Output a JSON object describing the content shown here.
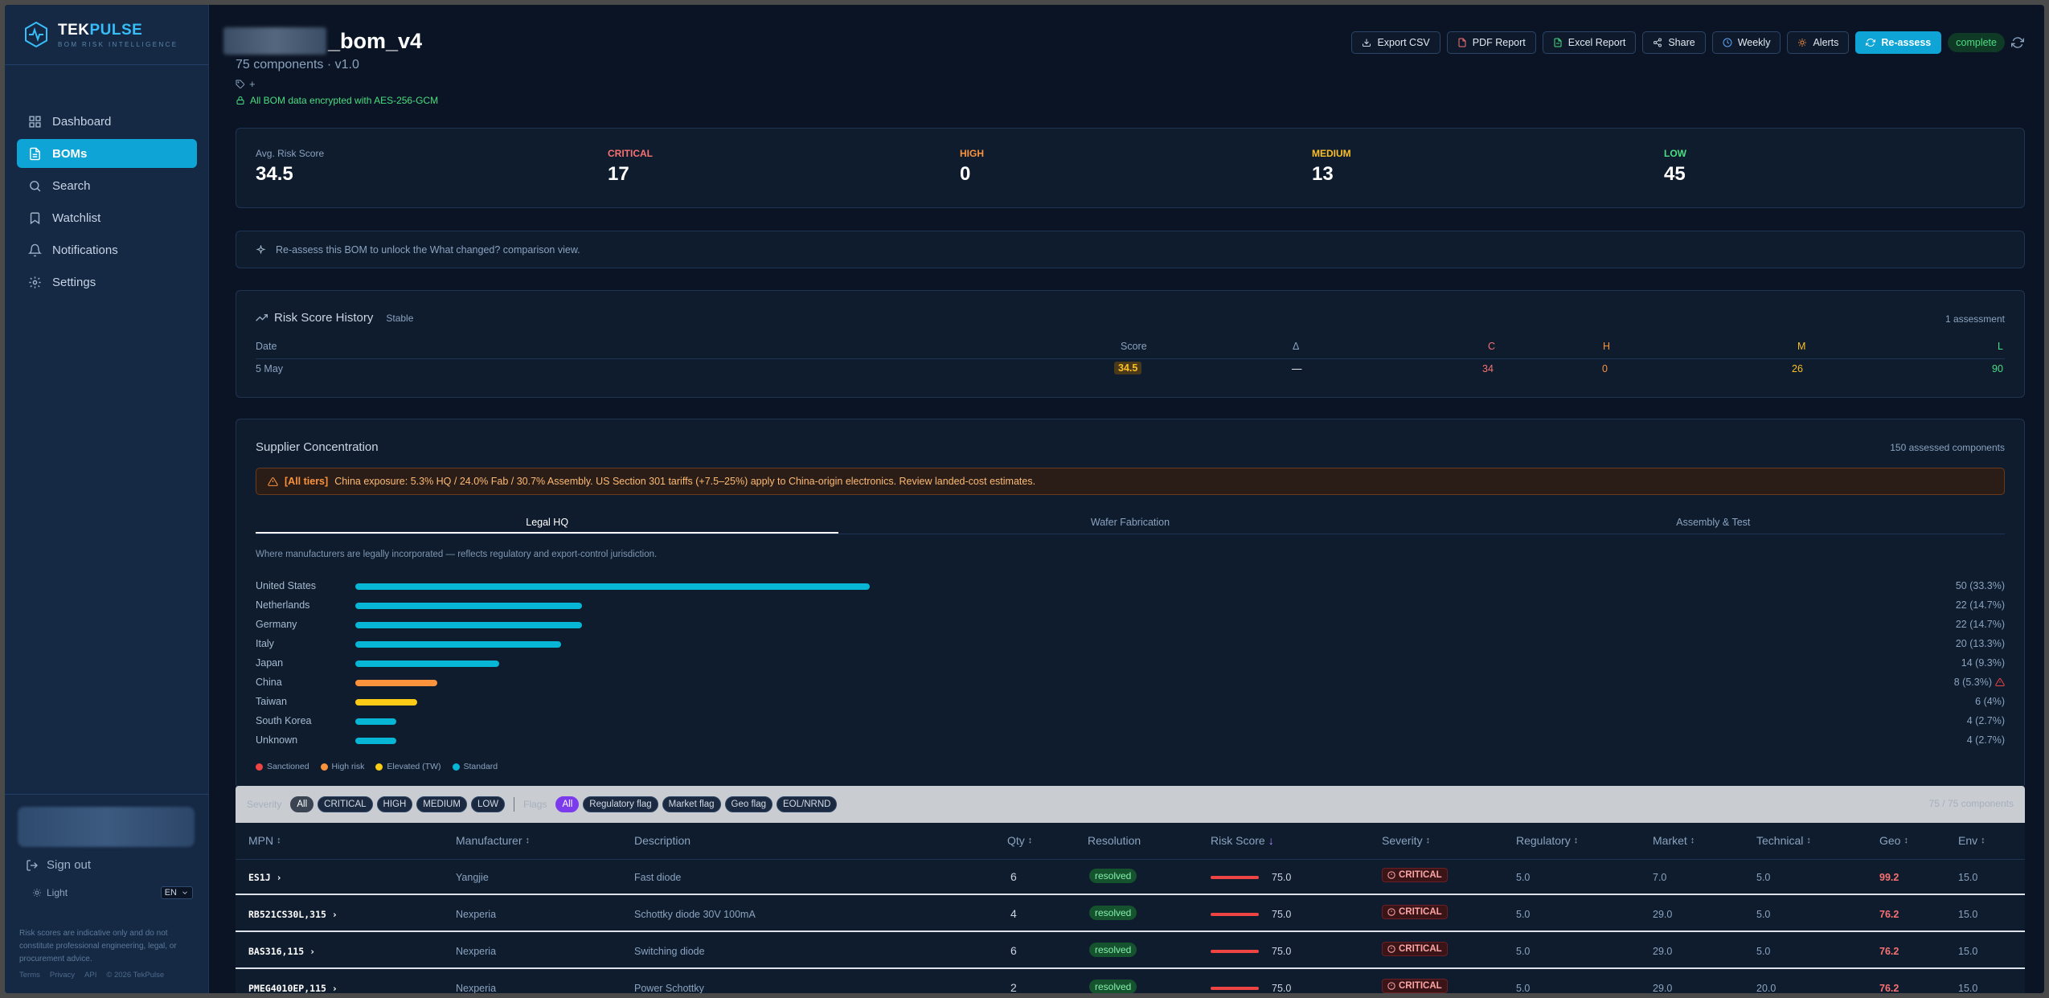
{
  "brand": {
    "name_a": "TEK",
    "name_b": "PULSE",
    "tagline": "BOM RISK INTELLIGENCE"
  },
  "sidebar": {
    "items": [
      {
        "label": "Dashboard",
        "icon": "grid-icon"
      },
      {
        "label": "BOMs",
        "icon": "document-icon"
      },
      {
        "label": "Search",
        "icon": "search-icon"
      },
      {
        "label": "Watchlist",
        "icon": "bookmark-icon"
      },
      {
        "label": "Notifications",
        "icon": "bell-icon"
      },
      {
        "label": "Settings",
        "icon": "gear-icon"
      }
    ],
    "sign_out": "Sign out",
    "theme_label": "Light",
    "language": "EN",
    "disclaimer": "Risk scores are indicative only and do not constitute professional engineering, legal, or procurement advice.",
    "footer": {
      "terms": "Terms",
      "privacy": "Privacy",
      "api": "API",
      "copyright": "© 2026 TekPulse"
    }
  },
  "header": {
    "title_suffix": "_bom_v4",
    "subtitle": "75 components · v1.0",
    "tag_add": "+",
    "encryption": "All BOM data encrypted with AES-256-GCM"
  },
  "toolbar": {
    "export_csv": "Export CSV",
    "pdf_report": "PDF Report",
    "excel_report": "Excel Report",
    "share": "Share",
    "weekly": "Weekly",
    "alerts": "Alerts",
    "reassess": "Re-assess",
    "status": "complete"
  },
  "stats": {
    "avg_label": "Avg. Risk Score",
    "avg_value": "34.5",
    "critical_label": "CRITICAL",
    "critical_value": "17",
    "high_label": "HIGH",
    "high_value": "0",
    "medium_label": "MEDIUM",
    "medium_value": "13",
    "low_label": "LOW",
    "low_value": "45"
  },
  "info_banner": "Re-assess this BOM to unlock the What changed? comparison view.",
  "history": {
    "title": "Risk Score History",
    "trend": "Stable",
    "count": "1 assessment",
    "headers": {
      "date": "Date",
      "score": "Score",
      "delta": "Δ",
      "c": "C",
      "h": "H",
      "m": "M",
      "l": "L"
    },
    "rows": [
      {
        "date": "5 May",
        "score": "34.5",
        "delta": "—",
        "c": "34",
        "h": "0",
        "m": "26",
        "l": "90"
      }
    ]
  },
  "supplier": {
    "title": "Supplier Concentration",
    "count": "150 assessed components",
    "alert_tag": "[All tiers]",
    "alert_text": "China exposure: 5.3% HQ / 24.0% Fab / 30.7% Assembly. US Section 301 tariffs (+7.5–25%) apply to China-origin electronics. Review landed-cost estimates.",
    "tabs": [
      "Legal HQ",
      "Wafer Fabrication",
      "Assembly & Test"
    ],
    "active_tab": 0,
    "tab_description": "Where manufacturers are legally incorporated — reflects regulatory and export-control jurisdiction.",
    "rows": [
      {
        "country": "United States",
        "count": 50,
        "label": "50 (33.3%)",
        "risk": "standard"
      },
      {
        "country": "Netherlands",
        "count": 22,
        "label": "22 (14.7%)",
        "risk": "standard"
      },
      {
        "country": "Germany",
        "count": 22,
        "label": "22 (14.7%)",
        "risk": "standard"
      },
      {
        "country": "Italy",
        "count": 20,
        "label": "20 (13.3%)",
        "risk": "standard"
      },
      {
        "country": "Japan",
        "count": 14,
        "label": "14 (9.3%)",
        "risk": "standard"
      },
      {
        "country": "China",
        "count": 8,
        "label": "8 (5.3%)",
        "risk": "high",
        "warn": true
      },
      {
        "country": "Taiwan",
        "count": 6,
        "label": "6 (4%)",
        "risk": "elevated"
      },
      {
        "country": "South Korea",
        "count": 4,
        "label": "4 (2.7%)",
        "risk": "standard"
      },
      {
        "country": "Unknown",
        "count": 4,
        "label": "4 (2.7%)",
        "risk": "standard"
      }
    ],
    "legend": [
      {
        "label": "Sanctioned",
        "color": "#ef4444"
      },
      {
        "label": "High risk",
        "color": "#fb923c"
      },
      {
        "label": "Elevated (TW)",
        "color": "#facc15"
      },
      {
        "label": "Standard",
        "color": "#06b6d4"
      }
    ],
    "colors": {
      "standard": "#06b6d4",
      "high": "#fb923c",
      "elevated": "#facc15",
      "sanctioned": "#ef4444"
    }
  },
  "filters": {
    "severity_label": "Severity",
    "severity": [
      "All",
      "CRITICAL",
      "HIGH",
      "MEDIUM",
      "LOW"
    ],
    "flags_label": "Flags",
    "flags": [
      "All",
      "Regulatory flag",
      "Market flag",
      "Geo flag",
      "EOL/NRND"
    ],
    "count": "75 / 75 components"
  },
  "table": {
    "headers": [
      "MPN",
      "Manufacturer",
      "Description",
      "Qty",
      "Resolution",
      "Risk Score",
      "Severity",
      "Regulatory",
      "Market",
      "Technical",
      "Geo",
      "Env"
    ],
    "rows": [
      {
        "mpn": "ES1J",
        "manufacturer": "Yangjie",
        "description": "Fast diode",
        "qty": "6",
        "resolution": "resolved",
        "risk": "75.0",
        "severity": "CRITICAL",
        "regulatory": "5.0",
        "market": "7.0",
        "technical": "5.0",
        "geo": "99.2",
        "env": "15.0"
      },
      {
        "mpn": "RB521CS30L,315",
        "manufacturer": "Nexperia",
        "description": "Schottky diode 30V 100mA",
        "qty": "4",
        "resolution": "resolved",
        "risk": "75.0",
        "severity": "CRITICAL",
        "regulatory": "5.0",
        "market": "29.0",
        "technical": "5.0",
        "geo": "76.2",
        "env": "15.0"
      },
      {
        "mpn": "BAS316,115",
        "manufacturer": "Nexperia",
        "description": "Switching diode",
        "qty": "6",
        "resolution": "resolved",
        "risk": "75.0",
        "severity": "CRITICAL",
        "regulatory": "5.0",
        "market": "29.0",
        "technical": "5.0",
        "geo": "76.2",
        "env": "15.0"
      },
      {
        "mpn": "PMEG4010EP,115",
        "manufacturer": "Nexperia",
        "description": "Power Schottky",
        "qty": "2",
        "resolution": "resolved",
        "risk": "75.0",
        "severity": "CRITICAL",
        "regulatory": "5.0",
        "market": "29.0",
        "technical": "20.0",
        "geo": "76.2",
        "env": "15.0"
      }
    ]
  }
}
